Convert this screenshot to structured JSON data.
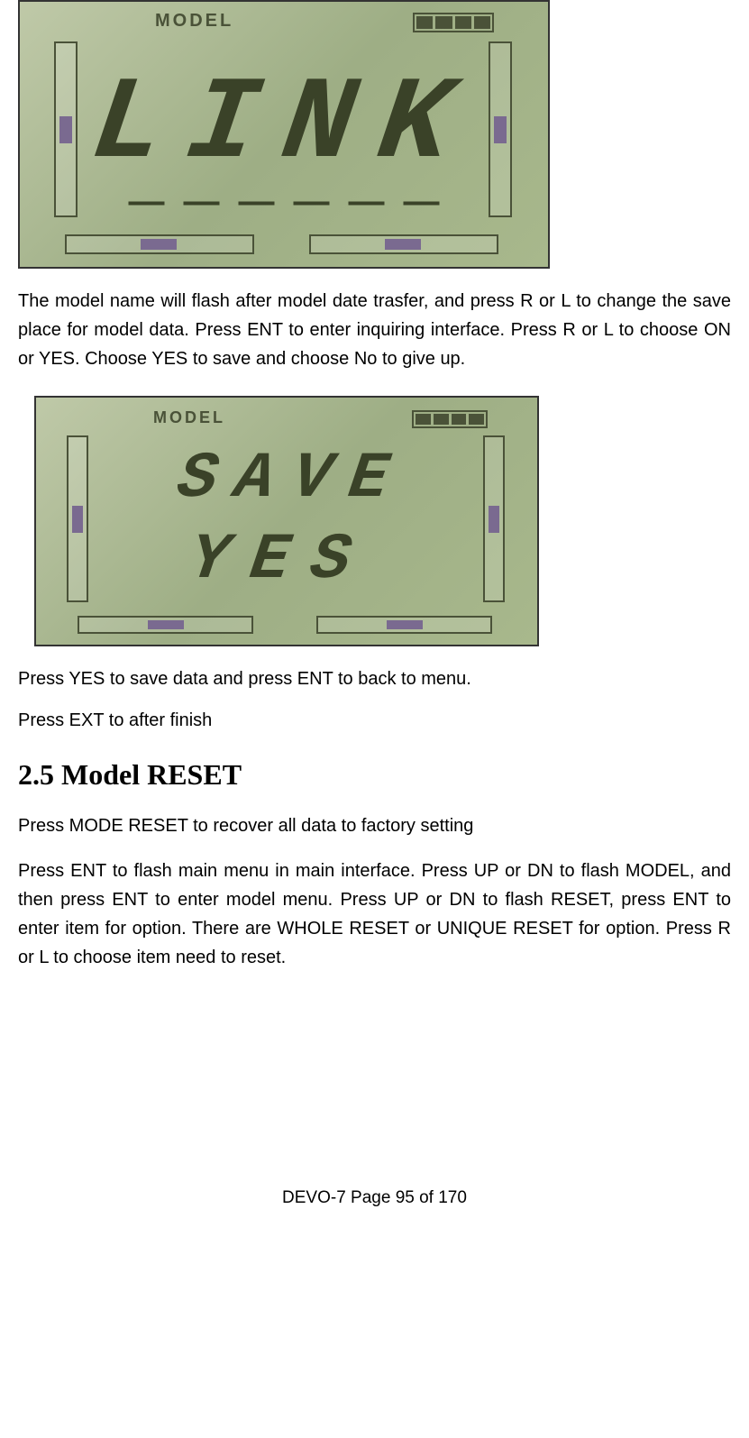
{
  "lcd1": {
    "label": "MODEL",
    "big_text": "LINK",
    "dashes": "— — — — — —"
  },
  "para1": "The model name will flash after model date trasfer, and press R or L to change the save place for model data. Press ENT to enter inquiring interface. Press R or L to choose ON or YES. Choose YES to save and choose No to give up.",
  "lcd2": {
    "label": "MODEL",
    "line1": "SAVE",
    "line2": "YES"
  },
  "para2": "Press YES to save data and press ENT to back to menu.",
  "para3": "Press EXT to after finish",
  "section_heading": "2.5 Model RESET",
  "para4": "Press MODE RESET to recover all data to factory setting",
  "para5": "Press ENT to flash main menu in main interface. Press UP or DN to flash MODEL, and then press ENT to enter model menu. Press UP or DN to flash RESET, press ENT to enter item for option. There are WHOLE RESET or UNIQUE RESET for option. Press R or L to choose item need to reset.",
  "footer": "DEVO-7      Page 95 of 170"
}
